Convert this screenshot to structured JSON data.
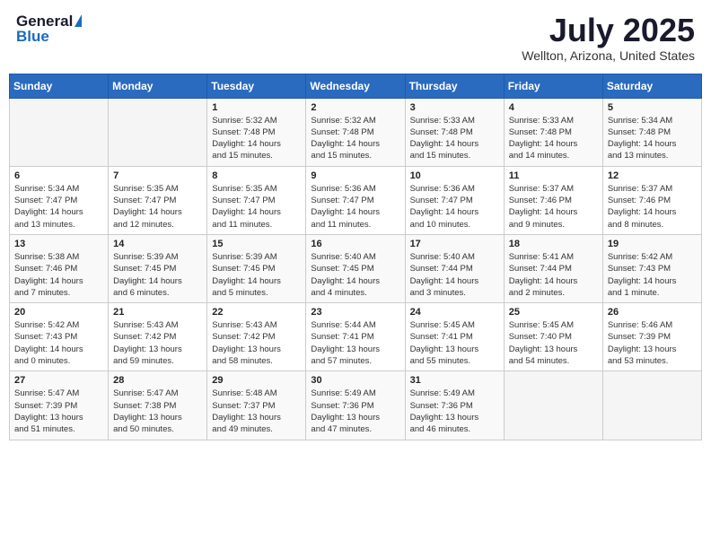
{
  "header": {
    "logo_general": "General",
    "logo_blue": "Blue",
    "title": "July 2025",
    "location": "Wellton, Arizona, United States"
  },
  "weekdays": [
    "Sunday",
    "Monday",
    "Tuesday",
    "Wednesday",
    "Thursday",
    "Friday",
    "Saturday"
  ],
  "weeks": [
    [
      {
        "day": "",
        "info": ""
      },
      {
        "day": "",
        "info": ""
      },
      {
        "day": "1",
        "info": "Sunrise: 5:32 AM\nSunset: 7:48 PM\nDaylight: 14 hours\nand 15 minutes."
      },
      {
        "day": "2",
        "info": "Sunrise: 5:32 AM\nSunset: 7:48 PM\nDaylight: 14 hours\nand 15 minutes."
      },
      {
        "day": "3",
        "info": "Sunrise: 5:33 AM\nSunset: 7:48 PM\nDaylight: 14 hours\nand 15 minutes."
      },
      {
        "day": "4",
        "info": "Sunrise: 5:33 AM\nSunset: 7:48 PM\nDaylight: 14 hours\nand 14 minutes."
      },
      {
        "day": "5",
        "info": "Sunrise: 5:34 AM\nSunset: 7:48 PM\nDaylight: 14 hours\nand 13 minutes."
      }
    ],
    [
      {
        "day": "6",
        "info": "Sunrise: 5:34 AM\nSunset: 7:47 PM\nDaylight: 14 hours\nand 13 minutes."
      },
      {
        "day": "7",
        "info": "Sunrise: 5:35 AM\nSunset: 7:47 PM\nDaylight: 14 hours\nand 12 minutes."
      },
      {
        "day": "8",
        "info": "Sunrise: 5:35 AM\nSunset: 7:47 PM\nDaylight: 14 hours\nand 11 minutes."
      },
      {
        "day": "9",
        "info": "Sunrise: 5:36 AM\nSunset: 7:47 PM\nDaylight: 14 hours\nand 11 minutes."
      },
      {
        "day": "10",
        "info": "Sunrise: 5:36 AM\nSunset: 7:47 PM\nDaylight: 14 hours\nand 10 minutes."
      },
      {
        "day": "11",
        "info": "Sunrise: 5:37 AM\nSunset: 7:46 PM\nDaylight: 14 hours\nand 9 minutes."
      },
      {
        "day": "12",
        "info": "Sunrise: 5:37 AM\nSunset: 7:46 PM\nDaylight: 14 hours\nand 8 minutes."
      }
    ],
    [
      {
        "day": "13",
        "info": "Sunrise: 5:38 AM\nSunset: 7:46 PM\nDaylight: 14 hours\nand 7 minutes."
      },
      {
        "day": "14",
        "info": "Sunrise: 5:39 AM\nSunset: 7:45 PM\nDaylight: 14 hours\nand 6 minutes."
      },
      {
        "day": "15",
        "info": "Sunrise: 5:39 AM\nSunset: 7:45 PM\nDaylight: 14 hours\nand 5 minutes."
      },
      {
        "day": "16",
        "info": "Sunrise: 5:40 AM\nSunset: 7:45 PM\nDaylight: 14 hours\nand 4 minutes."
      },
      {
        "day": "17",
        "info": "Sunrise: 5:40 AM\nSunset: 7:44 PM\nDaylight: 14 hours\nand 3 minutes."
      },
      {
        "day": "18",
        "info": "Sunrise: 5:41 AM\nSunset: 7:44 PM\nDaylight: 14 hours\nand 2 minutes."
      },
      {
        "day": "19",
        "info": "Sunrise: 5:42 AM\nSunset: 7:43 PM\nDaylight: 14 hours\nand 1 minute."
      }
    ],
    [
      {
        "day": "20",
        "info": "Sunrise: 5:42 AM\nSunset: 7:43 PM\nDaylight: 14 hours\nand 0 minutes."
      },
      {
        "day": "21",
        "info": "Sunrise: 5:43 AM\nSunset: 7:42 PM\nDaylight: 13 hours\nand 59 minutes."
      },
      {
        "day": "22",
        "info": "Sunrise: 5:43 AM\nSunset: 7:42 PM\nDaylight: 13 hours\nand 58 minutes."
      },
      {
        "day": "23",
        "info": "Sunrise: 5:44 AM\nSunset: 7:41 PM\nDaylight: 13 hours\nand 57 minutes."
      },
      {
        "day": "24",
        "info": "Sunrise: 5:45 AM\nSunset: 7:41 PM\nDaylight: 13 hours\nand 55 minutes."
      },
      {
        "day": "25",
        "info": "Sunrise: 5:45 AM\nSunset: 7:40 PM\nDaylight: 13 hours\nand 54 minutes."
      },
      {
        "day": "26",
        "info": "Sunrise: 5:46 AM\nSunset: 7:39 PM\nDaylight: 13 hours\nand 53 minutes."
      }
    ],
    [
      {
        "day": "27",
        "info": "Sunrise: 5:47 AM\nSunset: 7:39 PM\nDaylight: 13 hours\nand 51 minutes."
      },
      {
        "day": "28",
        "info": "Sunrise: 5:47 AM\nSunset: 7:38 PM\nDaylight: 13 hours\nand 50 minutes."
      },
      {
        "day": "29",
        "info": "Sunrise: 5:48 AM\nSunset: 7:37 PM\nDaylight: 13 hours\nand 49 minutes."
      },
      {
        "day": "30",
        "info": "Sunrise: 5:49 AM\nSunset: 7:36 PM\nDaylight: 13 hours\nand 47 minutes."
      },
      {
        "day": "31",
        "info": "Sunrise: 5:49 AM\nSunset: 7:36 PM\nDaylight: 13 hours\nand 46 minutes."
      },
      {
        "day": "",
        "info": ""
      },
      {
        "day": "",
        "info": ""
      }
    ]
  ]
}
